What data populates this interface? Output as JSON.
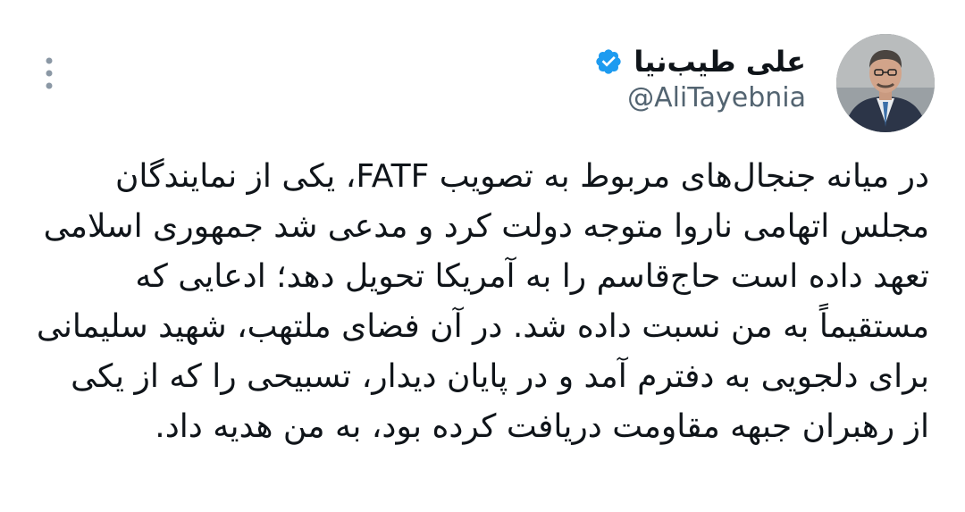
{
  "tweet": {
    "author": {
      "display_name": "علی طیب‌نیا",
      "handle": "@AliTayebnia",
      "verified": true,
      "avatar": "avatar-photo"
    },
    "menu_icon": "more-vertical-icon",
    "text_lines": [
      "در میانه جنجال‌های مربوط به تصویب FATF، یکی از نمایندگان",
      "مجلس اتهامی ناروا متوجه دولت کرد و مدعی شد جمهوری اسلامی",
      "تعهد داده است حاج‌قاسم را به آمریکا تحویل دهد؛ ادعایی که",
      "مستقیماً به من نسبت داده شد. در آن فضای ملتهب، شهید سلیمانی",
      "برای دلجویی به دفترم آمد و در پایان دیدار، تسبیحی را که از یکی",
      "از رهبران جبهه مقاومت دریافت کرده بود، به من هدیه داد."
    ]
  },
  "colors": {
    "text": "#0f1419",
    "secondary_text": "#536471",
    "verified_badge": "#1d9bf0",
    "background": "#ffffff"
  }
}
